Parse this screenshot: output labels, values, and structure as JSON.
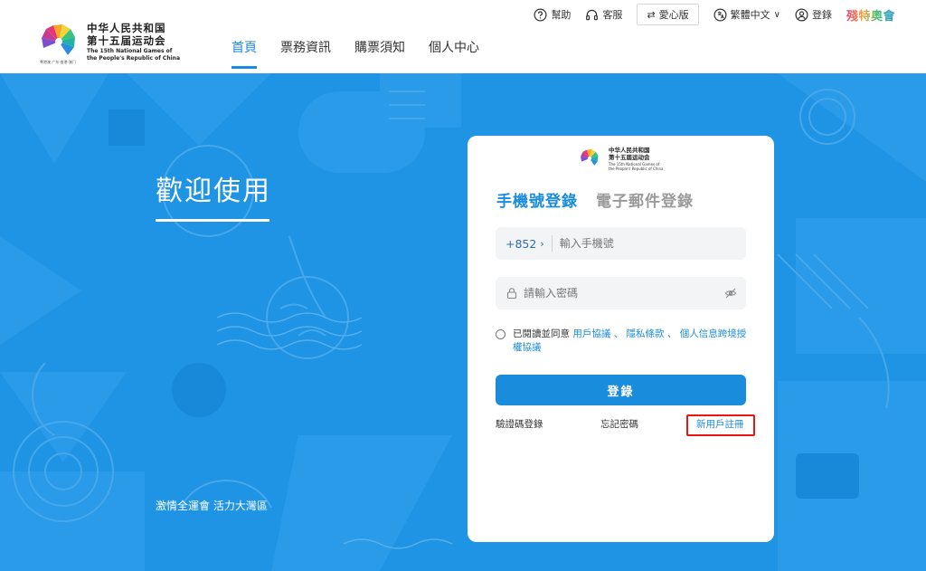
{
  "header": {
    "logo": {
      "title_cn": "中华人民共和国\n第十五届运动会",
      "title_en": "The 15th National Games of\nthe People's Republic of China",
      "tagline": "粤港澳 广东·香港·澳门"
    },
    "nav": [
      {
        "label": "首頁",
        "active": true
      },
      {
        "label": "票務資訊",
        "active": false
      },
      {
        "label": "購票須知",
        "active": false
      },
      {
        "label": "個人中心",
        "active": false
      }
    ],
    "topbar": {
      "help": "幫助",
      "service": "客服",
      "care_mode": "愛心版",
      "language": "繁體中文",
      "login": "登錄",
      "paralympic": "殘特奧會"
    }
  },
  "hero": {
    "welcome": "歡迎使用",
    "slogan": "激情全運會 活力大灣區"
  },
  "login_card": {
    "logo_cn": "中华人民共和国\n第十五届运动会",
    "logo_en": "The 15th National Games of\nthe People's Republic of China",
    "tabs": [
      {
        "label": "手機號登錄",
        "active": true
      },
      {
        "label": "電子郵件登錄",
        "active": false
      }
    ],
    "phone": {
      "country_code": "+852",
      "value": "",
      "placeholder": "輸入手機號"
    },
    "password": {
      "value": "",
      "placeholder": "請輸入密碼"
    },
    "agreement": {
      "prefix": "已閱讀並同意",
      "link1": "用戶協議",
      "sep1": "、",
      "link2": "隱私條款",
      "sep2": "、",
      "link3": "個人信息跨境授權協議"
    },
    "login_button": "登錄",
    "links": {
      "sms_login": "驗證碼登錄",
      "forgot": "忘記密碼",
      "register": "新用戶註冊"
    }
  },
  "colors": {
    "primary": "#1a8cdc",
    "hero_bg": "#1f93e4",
    "highlight_box": "#e8180f"
  }
}
